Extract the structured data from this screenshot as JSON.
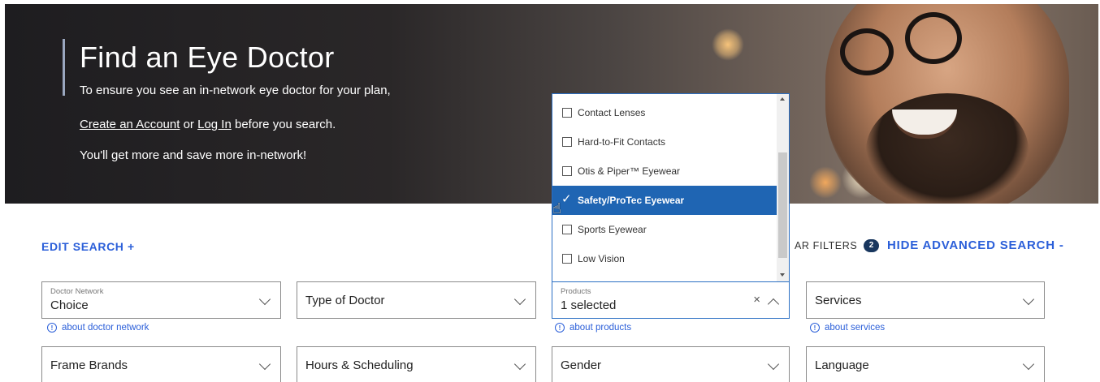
{
  "hero": {
    "title": "Find an Eye Doctor",
    "line1": "To ensure you see an in-network eye doctor for your plan,",
    "create_account": "Create an Account",
    "or_text": " or ",
    "log_in": "Log In",
    "line2_tail": " before you search.",
    "line3": "You'll get more and save more in-network!"
  },
  "controls": {
    "edit_search": "EDIT SEARCH +",
    "clear_filters": "AR FILTERS",
    "badge_count": "2",
    "hide_advanced": "HIDE ADVANCED SEARCH -"
  },
  "filters": {
    "doctor_network": {
      "label": "Doctor Network",
      "value": "Choice",
      "about": "about doctor network"
    },
    "type_of_doctor": {
      "value": "Type of Doctor"
    },
    "products": {
      "label": "Products",
      "value": "1 selected",
      "clear": "×",
      "about": "about products"
    },
    "services": {
      "value": "Services",
      "about": "about services"
    },
    "frame_brands": {
      "value": "Frame Brands"
    },
    "hours": {
      "value": "Hours & Scheduling"
    },
    "gender": {
      "value": "Gender"
    },
    "language": {
      "value": "Language"
    }
  },
  "products_dropdown": {
    "items": [
      {
        "label": "Contact Lenses",
        "checked": false
      },
      {
        "label": "Hard-to-Fit Contacts",
        "checked": false
      },
      {
        "label": "Otis & Piper™ Eyewear",
        "checked": false
      },
      {
        "label": "Safety/ProTec Eyewear",
        "checked": true
      },
      {
        "label": "Sports Eyewear",
        "checked": false
      },
      {
        "label": "Low Vision",
        "checked": false
      }
    ]
  },
  "colors": {
    "link_blue": "#2b5fd9",
    "selected_blue": "#1f65b3",
    "badge_navy": "#18365e"
  },
  "icons": {
    "info": "info-icon",
    "chevron": "chevron-down-icon",
    "checkbox": "checkbox-icon",
    "cursor": "hand-cursor-icon"
  }
}
